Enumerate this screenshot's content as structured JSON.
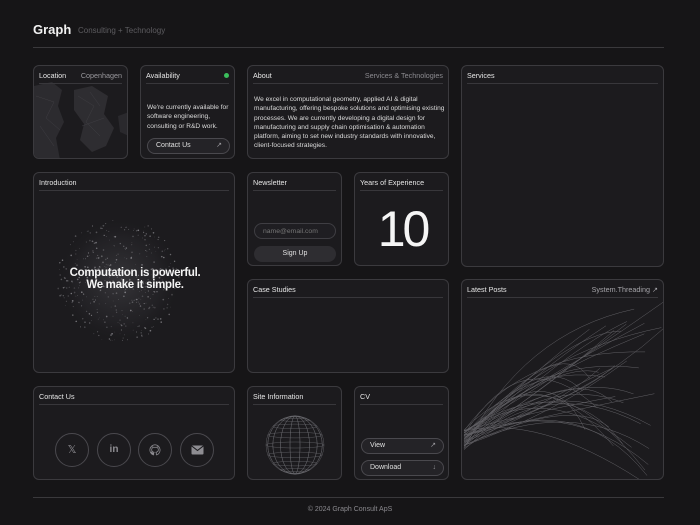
{
  "header": {
    "brand": "Graph",
    "tagline": "Consulting + Technology"
  },
  "location": {
    "title": "Location",
    "value": "Copenhagen"
  },
  "availability": {
    "title": "Availability",
    "text": "We're currently available for software engineering, consulting or R&D work.",
    "button": "Contact Us",
    "status_color": "#3bbf5c"
  },
  "about": {
    "title": "About",
    "subtitle": "Services & Technologies",
    "text": "We excel in computational geometry, applied AI & digital manufacturing, offering bespoke solutions and optimising existing processes. We are currently developing a digital design for manufacturing and supply chain optimisation & automation platform, aiming to set new industry standards with innovative, client-focused strategies."
  },
  "services": {
    "title": "Services"
  },
  "introduction": {
    "title": "Introduction",
    "line1": "Computation is powerful.",
    "line2": "We make it simple."
  },
  "newsletter": {
    "title": "Newsletter",
    "placeholder": "name@email.com",
    "button": "Sign Up"
  },
  "experience": {
    "title": "Years of Experience",
    "value": "10"
  },
  "case_studies": {
    "title": "Case Studies"
  },
  "latest_posts": {
    "title": "Latest Posts",
    "link": "System.Threading"
  },
  "contact": {
    "title": "Contact Us",
    "icons": [
      "x-icon",
      "linkedin-icon",
      "github-icon",
      "mail-icon"
    ]
  },
  "site_info": {
    "title": "Site Information"
  },
  "cv": {
    "title": "CV",
    "view": "View",
    "download": "Download"
  },
  "footer": {
    "text": "© 2024 Graph Consult ApS"
  }
}
